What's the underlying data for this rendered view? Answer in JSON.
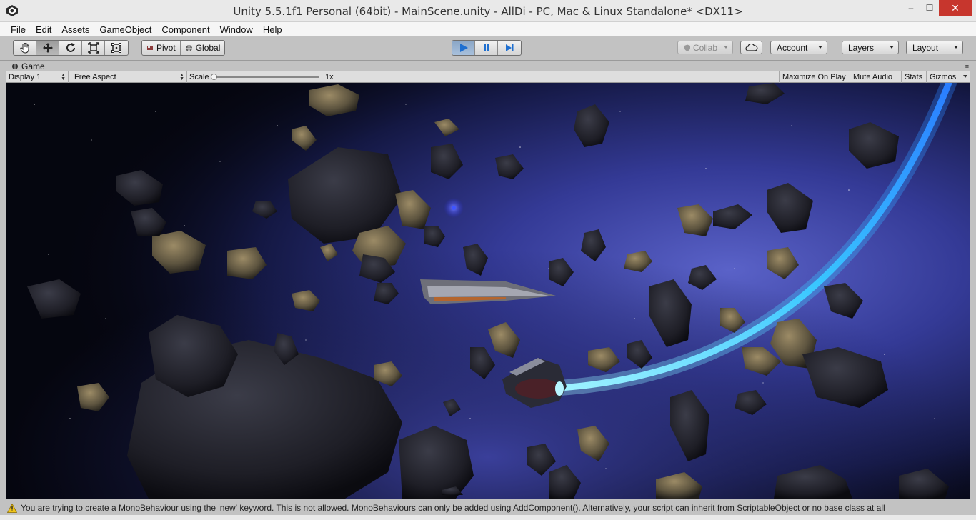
{
  "window": {
    "title": "Unity 5.5.1f1 Personal (64bit) - MainScene.unity - AllDi - PC, Mac & Linux Standalone* <DX11>",
    "minimize": "–",
    "maximize": "☐",
    "close": "✕"
  },
  "menu": {
    "items": [
      "File",
      "Edit",
      "Assets",
      "GameObject",
      "Component",
      "Window",
      "Help"
    ]
  },
  "toolbar": {
    "tools": [
      "hand-tool",
      "move-tool",
      "rotate-tool",
      "scale-tool",
      "rect-tool"
    ],
    "active_tool": "move-tool",
    "pivot_label": "Pivot",
    "global_label": "Global",
    "collab_label": "Collab",
    "account_label": "Account",
    "layers_label": "Layers",
    "layout_label": "Layout",
    "accent": "#2f7fd6"
  },
  "game_panel": {
    "tab_label": "Game",
    "display_label": "Display 1",
    "aspect_label": "Free Aspect",
    "scale_label": "Scale",
    "scale_value_label": "1x",
    "scale_value": 1,
    "maximize_label": "Maximize On Play",
    "mute_label": "Mute Audio",
    "stats_label": "Stats",
    "gizmos_label": "Gizmos"
  },
  "status": {
    "icon": "warning-icon",
    "message": "You are trying to create a MonoBehaviour using the 'new' keyword.  This is not allowed.  MonoBehaviours can only be added using AddComponent().  Alternatively, your script can inherit from ScriptableObject or no base class at all"
  }
}
